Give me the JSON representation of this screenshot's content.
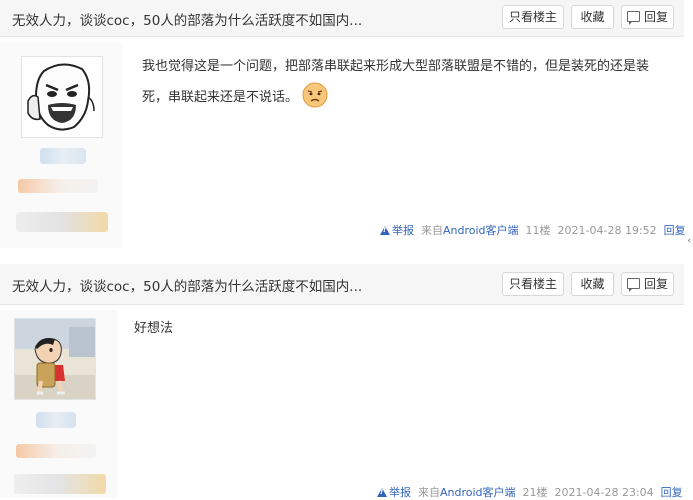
{
  "posts": [
    {
      "thread_title": "无效人力，谈谈coc，50人的部落为什么活跃度不如国内...",
      "buttons": {
        "only_op": "只看楼主",
        "favorite": "收藏",
        "reply": "回复"
      },
      "content_lines": [
        "我也觉得这是一个问题，把部落串联起来形成大型部落联盟是不错的，但是装死的还是装",
        "死，串联起来还是不说话。"
      ],
      "emoji": "frown-emoji",
      "meta": {
        "report": "举报",
        "source_prefix": "来自",
        "source_link": "Android客户端",
        "floor": "11楼",
        "time": "2021-04-28 19:52",
        "reply": "回复"
      }
    },
    {
      "thread_title": "无效人力，谈谈coc，50人的部落为什么活跃度不如国内...",
      "buttons": {
        "only_op": "只看楼主",
        "favorite": "收藏",
        "reply": "回复"
      },
      "content_lines": [
        "好想法"
      ],
      "meta": {
        "report": "举报",
        "source_prefix": "来自",
        "source_link": "Android客户端",
        "floor": "21楼",
        "time": "2021-04-28 23:04",
        "reply": "回复"
      }
    }
  ],
  "colors": {
    "link": "#3366bb",
    "meta": "#999999",
    "header_bg": "#f6f6f6"
  }
}
